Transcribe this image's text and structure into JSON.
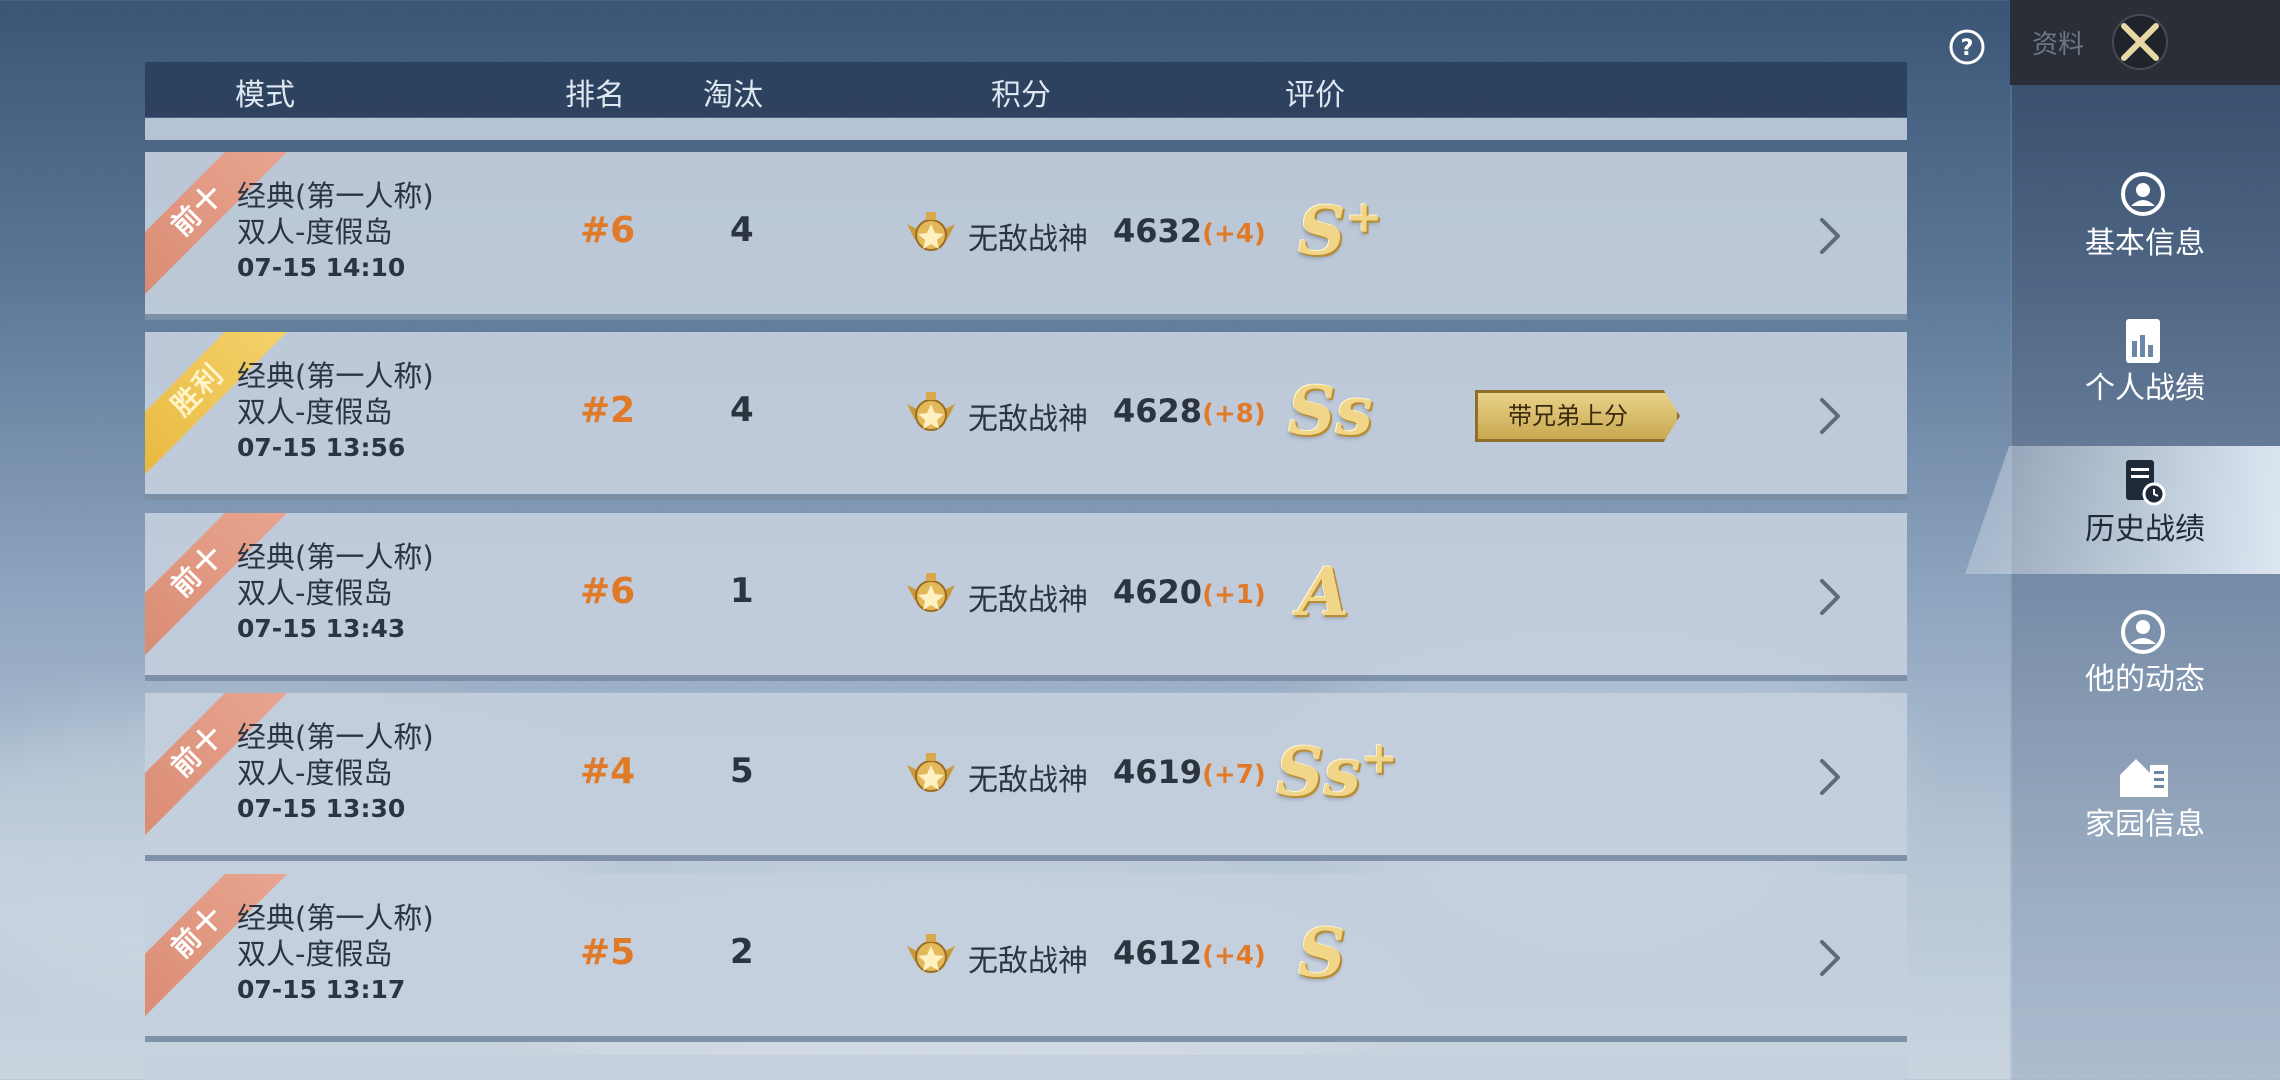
{
  "header": {
    "columns": [
      "模式",
      "排名",
      "淘汰",
      "积分",
      "评价"
    ]
  },
  "rows": [
    {
      "ribbon": "前十",
      "ribbon_type": "top10",
      "mode": "经典(第一人称)",
      "map": "双人-度假岛",
      "date": "07-15 14:10",
      "rank": "#6",
      "kills": "4",
      "tier": "无敌战神",
      "score": "4632",
      "delta": "(+4)",
      "grade": "S",
      "grade_sup": "+",
      "tag": ""
    },
    {
      "ribbon": "胜利",
      "ribbon_type": "win",
      "mode": "经典(第一人称)",
      "map": "双人-度假岛",
      "date": "07-15 13:56",
      "rank": "#2",
      "kills": "4",
      "tier": "无敌战神",
      "score": "4628",
      "delta": "(+8)",
      "grade": "Ss",
      "grade_sup": "",
      "tag": "带兄弟上分"
    },
    {
      "ribbon": "前十",
      "ribbon_type": "top10",
      "mode": "经典(第一人称)",
      "map": "双人-度假岛",
      "date": "07-15 13:43",
      "rank": "#6",
      "kills": "1",
      "tier": "无敌战神",
      "score": "4620",
      "delta": "(+1)",
      "grade": "A",
      "grade_sup": "",
      "tag": ""
    },
    {
      "ribbon": "前十",
      "ribbon_type": "top10",
      "mode": "经典(第一人称)",
      "map": "双人-度假岛",
      "date": "07-15 13:30",
      "rank": "#4",
      "kills": "5",
      "tier": "无敌战神",
      "score": "4619",
      "delta": "(+7)",
      "grade": "Ss",
      "grade_sup": "+",
      "tag": ""
    },
    {
      "ribbon": "前十",
      "ribbon_type": "top10",
      "mode": "经典(第一人称)",
      "map": "双人-度假岛",
      "date": "07-15 13:17",
      "rank": "#5",
      "kills": "2",
      "tier": "无敌战神",
      "score": "4612",
      "delta": "(+4)",
      "grade": "S",
      "grade_sup": "",
      "tag": ""
    }
  ],
  "sidebar": {
    "title": "资料",
    "items": [
      {
        "label": "基本信息",
        "icon": "profile-icon",
        "active": false
      },
      {
        "label": "个人战绩",
        "icon": "stats-icon",
        "active": false
      },
      {
        "label": "历史战绩",
        "icon": "history-icon",
        "active": true
      },
      {
        "label": "他的动态",
        "icon": "activity-icon",
        "active": false
      },
      {
        "label": "家园信息",
        "icon": "home-icon",
        "active": false
      }
    ]
  },
  "colors": {
    "accent_orange": "#e07a28",
    "gold": "#f1d68a",
    "ribbon_top10": "#d98a72",
    "ribbon_win": "#e9b73c"
  }
}
